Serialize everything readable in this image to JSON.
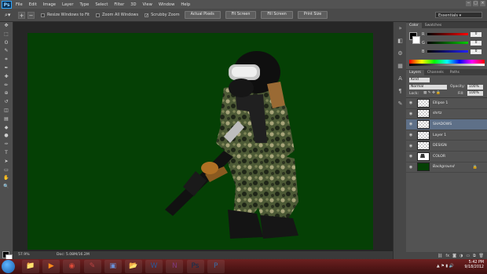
{
  "app": {
    "logo_text": "Ps",
    "menu": [
      "File",
      "Edit",
      "Image",
      "Layer",
      "Type",
      "Select",
      "Filter",
      "3D",
      "View",
      "Window",
      "Help"
    ],
    "window_buttons": [
      "−",
      "□",
      "×"
    ]
  },
  "options_bar": {
    "tool_icon": "zoom-icon",
    "checkboxes": [
      {
        "label": "Resize Windows to Fit",
        "checked": false
      },
      {
        "label": "Zoom All Windows",
        "checked": false
      },
      {
        "label": "Scrubby Zoom",
        "checked": true
      }
    ],
    "buttons": [
      "Actual Pixels",
      "Fit Screen",
      "Fill Screen",
      "Print Size"
    ],
    "workspace": "Essentials"
  },
  "toolbox": {
    "tools": [
      "move-icon",
      "marquee-icon",
      "lasso-icon",
      "quick-select-icon",
      "crop-icon",
      "eyedropper-icon",
      "healing-icon",
      "brush-icon",
      "clone-stamp-icon",
      "history-brush-icon",
      "eraser-icon",
      "gradient-icon",
      "blur-icon",
      "dodge-icon",
      "pen-icon",
      "type-icon",
      "path-select-icon",
      "shape-icon",
      "hand-icon",
      "zoom-icon"
    ],
    "glyphs": [
      "✥",
      "⬚",
      "ʘ",
      "✎",
      "⌗",
      "✒",
      "✚",
      "✏",
      "⊕",
      "↺",
      "◫",
      "▤",
      "◆",
      "●",
      "✑",
      "T",
      "➤",
      "▭",
      "✋",
      "🔍"
    ]
  },
  "status_bar": {
    "zoom": "57.9%",
    "doc": "Doc: 5.08M/16.2M"
  },
  "dock_icons": [
    "»",
    "◧",
    "⚙",
    "▦",
    "A",
    "¶",
    "✎"
  ],
  "color_panel": {
    "tabs": [
      "Color",
      "Swatches"
    ],
    "channels": [
      {
        "label": "R",
        "value": "0",
        "color": "#d33"
      },
      {
        "label": "G",
        "value": "0",
        "color": "#2a2"
      },
      {
        "label": "B",
        "value": "0",
        "color": "#33d"
      }
    ],
    "foreground": "#000000",
    "background": "#ffffff"
  },
  "layers_panel": {
    "tabs": [
      "Layers",
      "Channels",
      "Paths"
    ],
    "filter_kind": "Kind",
    "blend_mode": "Normal",
    "opacity_label": "Opacity:",
    "opacity_value": "100%",
    "lock_label": "Lock:",
    "fill_label": "Fill:",
    "fill_value": "100%",
    "layers": [
      {
        "name": "Ellipse 1",
        "thumb": "transparent",
        "selected": false,
        "locked": false
      },
      {
        "name": "shrtz",
        "thumb": "transparent",
        "selected": false,
        "locked": false
      },
      {
        "name": "SHADOWS",
        "thumb": "transparent",
        "selected": true,
        "locked": false
      },
      {
        "name": "Layer 1",
        "thumb": "transparent",
        "selected": false,
        "locked": false
      },
      {
        "name": "DESIGN",
        "thumb": "transparent",
        "selected": false,
        "locked": false
      },
      {
        "name": "COLOR",
        "thumb": "figure",
        "selected": false,
        "locked": false
      },
      {
        "name": "Background",
        "thumb": "green",
        "selected": false,
        "locked": true
      }
    ],
    "footer_icons": [
      "link-icon",
      "fx-icon",
      "mask-icon",
      "adjustment-icon",
      "folder-icon",
      "new-layer-icon",
      "trash-icon"
    ],
    "footer_glyphs": [
      "⛓",
      "fx",
      "◙",
      "◑",
      "▭",
      "⧉",
      "🗑"
    ]
  },
  "canvas": {
    "color": "#054005"
  },
  "taskbar": {
    "apps": [
      "explorer-icon",
      "media-player-icon",
      "chrome-icon",
      "paint-icon",
      "photo-viewer-icon",
      "folder-icon",
      "word-icon",
      "onenote-icon",
      "photoshop-icon",
      "unknown-app-icon"
    ],
    "glyphs": [
      "📁",
      "▶",
      "◉",
      "✎",
      "▣",
      "📂",
      "W",
      "N",
      "Ps",
      "P"
    ],
    "colors": [
      "#e8b64a",
      "#ff8c1a",
      "#dd4b39",
      "#b44",
      "#6a8fd6",
      "#e8c870",
      "#2b5797",
      "#80397b",
      "#0a2f52",
      "#3a6ea5"
    ],
    "time": "5:42 PM",
    "date": "9/18/2012"
  }
}
